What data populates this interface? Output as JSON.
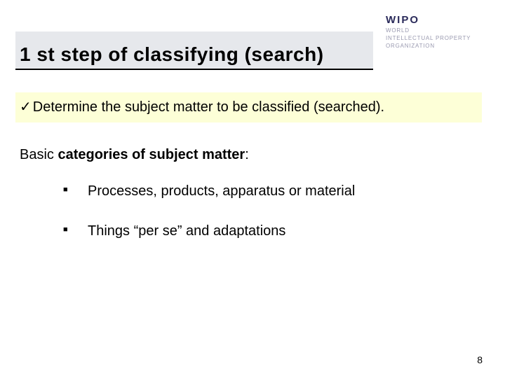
{
  "logo": {
    "main": "WIPO",
    "sub1": "WORLD",
    "sub2": "INTELLECTUAL PROPERTY",
    "sub3": "ORGANIZATION"
  },
  "title": "1 st step of classifying (search)",
  "highlight": {
    "check": "✓",
    "text": "Determine the subject matter to be classified (searched)."
  },
  "body": {
    "prefix": "Basic ",
    "bold": "categories of subject matter",
    "suffix": ":"
  },
  "bullets": [
    "Processes, products, apparatus or material",
    "Things “per se” and adaptations"
  ],
  "page_number": "8"
}
